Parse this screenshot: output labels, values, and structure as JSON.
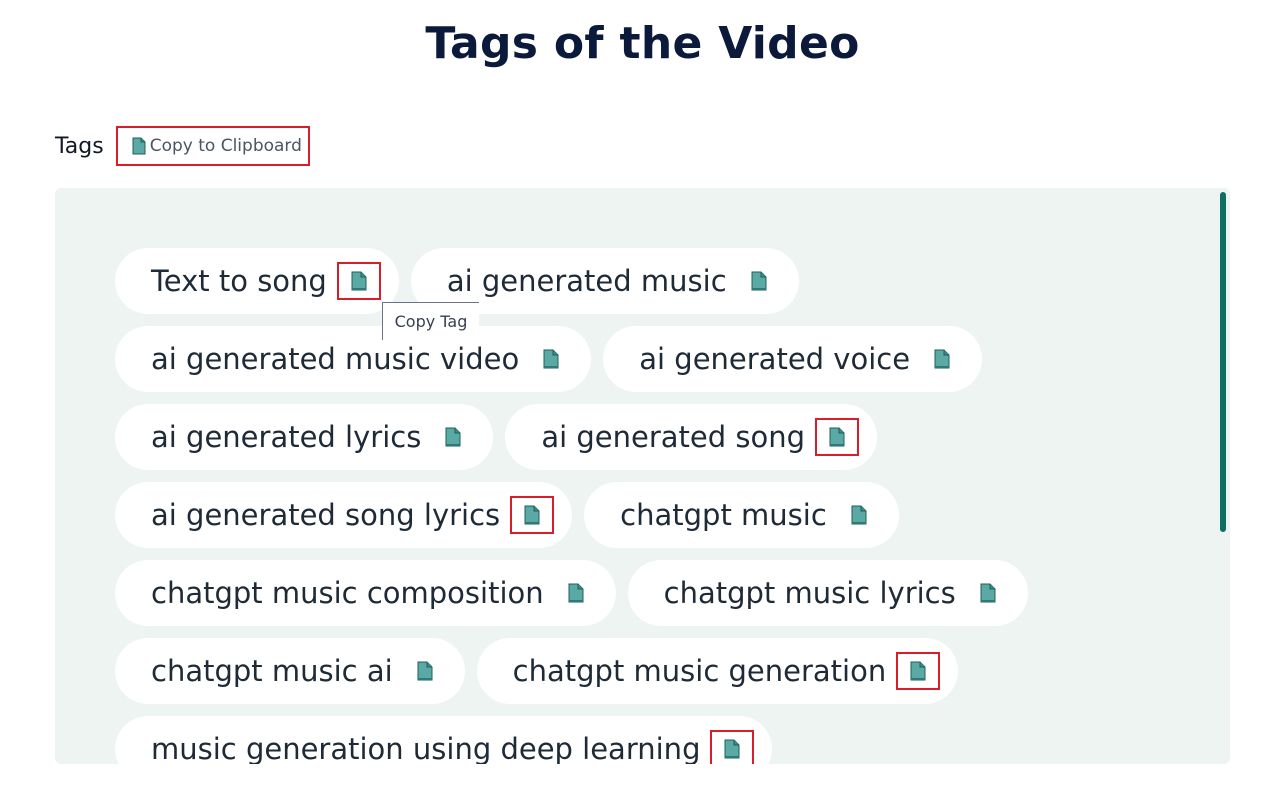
{
  "page": {
    "title": "Tags of the Video"
  },
  "tags_section": {
    "label": "Tags",
    "copy_button_label": "Copy to Clipboard"
  },
  "tooltip": {
    "text": "Copy Tag"
  },
  "colors": {
    "accent": "#0f6e62",
    "panel_bg": "#edf4f2",
    "highlight": "#d71f2b",
    "icon": "#5aa9a4"
  },
  "icons": {
    "copy": "document-copy-icon"
  },
  "tags": [
    {
      "label": "Text to song",
      "highlighted": true
    },
    {
      "label": "ai generated music",
      "highlighted": false
    },
    {
      "label": "ai generated music video",
      "highlighted": false
    },
    {
      "label": "ai generated voice",
      "highlighted": false
    },
    {
      "label": "ai generated lyrics",
      "highlighted": false
    },
    {
      "label": "ai generated song",
      "highlighted": true
    },
    {
      "label": "ai generated song lyrics",
      "highlighted": true
    },
    {
      "label": "chatgpt music",
      "highlighted": false
    },
    {
      "label": "chatgpt music composition",
      "highlighted": false
    },
    {
      "label": "chatgpt music lyrics",
      "highlighted": false
    },
    {
      "label": "chatgpt music ai",
      "highlighted": false
    },
    {
      "label": "chatgpt music generation",
      "highlighted": true
    },
    {
      "label": "music generation using deep learning",
      "highlighted": true
    }
  ]
}
